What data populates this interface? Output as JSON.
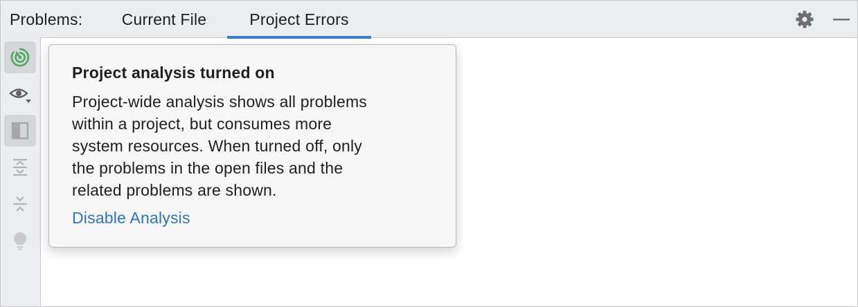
{
  "header": {
    "title": "Problems:",
    "tabs": [
      {
        "label": "Current File",
        "active": false
      },
      {
        "label": "Project Errors",
        "active": true
      }
    ],
    "actions": [
      "gear-icon",
      "minimize-icon"
    ]
  },
  "toolbar": {
    "buttons": [
      "project-analysis-icon",
      "eye-icon",
      "preview-panel-icon",
      "expand-all-icon",
      "collapse-all-icon",
      "lightbulb-icon"
    ]
  },
  "popup": {
    "title": "Project analysis turned on",
    "body": "Project-wide analysis shows all problems\nwithin a project, but consumes more\nsystem resources. When turned off, only\nthe problems in the open files and the\nrelated problems are shown.",
    "link": "Disable Analysis"
  },
  "colors": {
    "accent": "#3a7bd5",
    "link": "#2f74c0",
    "analysis_icon": "#4fa85a",
    "panel_bg": "#ebedf0",
    "popup_bg": "#f7f7f7"
  }
}
